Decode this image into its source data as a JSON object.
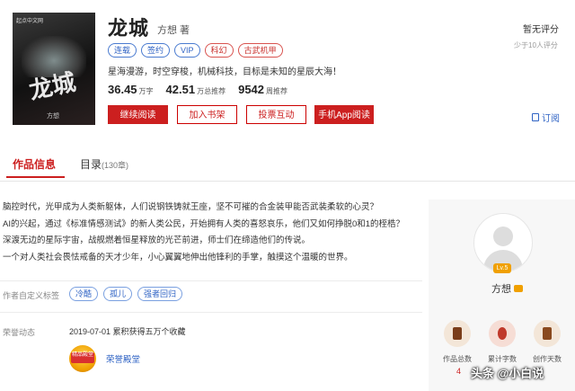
{
  "book": {
    "cover_publisher": "起点中文网",
    "cover_title": "龙城",
    "cover_author": "方想",
    "title": "龙城",
    "author_line": "方想 著",
    "tags": [
      "连载",
      "签约",
      "VIP",
      "科幻",
      "古武机甲"
    ],
    "intro": "星海漫游，时空穿梭，机械科技，目标是未知的星辰大海！",
    "stats": [
      {
        "value": "36.45",
        "unit": "万字"
      },
      {
        "value": "42.51",
        "unit": "万总推荐"
      },
      {
        "value": "9542",
        "unit": "周推荐"
      }
    ]
  },
  "buttons": {
    "read": "继续阅读",
    "shelf": "加入书架",
    "vote": "投票互动",
    "app": "手机App阅读"
  },
  "rating": {
    "text": "暂无评分",
    "sub": "少于10人评分"
  },
  "subscribe": "订阅",
  "tabs": {
    "info": "作品信息",
    "catalog": "目录",
    "catalog_count": "(130章)"
  },
  "description": [
    "脑控时代，光甲成为人类新躯体，人们说钢铁铸就王座，坚不可摧的合金装甲能否武装柔软的心灵？",
    "AI的兴起，通过《标准情感测试》的新人类公民，开始拥有人类的喜怒哀乐，他们又如何挣脱0和1的桎梏？",
    "深渡无边的星际宇宙，战舰燃着恒星释放的光芒前进，师士们在缔造他们的传说。",
    "一个对人类社会畏怯戒备的天才少年，小心翼翼地伸出他锋利的手掌，触摸这个温暖的世界。"
  ],
  "user_tags": {
    "label": "作者自定义标签",
    "items": [
      "冷酷",
      "孤儿",
      "强者回归"
    ]
  },
  "honor": {
    "label": "荣誉动态",
    "entry": "2019-07-01  累积获得五万个收藏",
    "medal_text": "精品殿堂",
    "link": "荣誉殿堂"
  },
  "author_panel": {
    "level": "Lv.5",
    "name": "方想",
    "stats": [
      {
        "label": "作品总数",
        "value": "4",
        "color": "#f3e6d8"
      },
      {
        "label": "累计字数",
        "value": "",
        "color": "#f6ddd5"
      },
      {
        "label": "创作天数",
        "value": "",
        "color": "#f3e6d8"
      }
    ]
  },
  "watermark": "头条 @小白说"
}
